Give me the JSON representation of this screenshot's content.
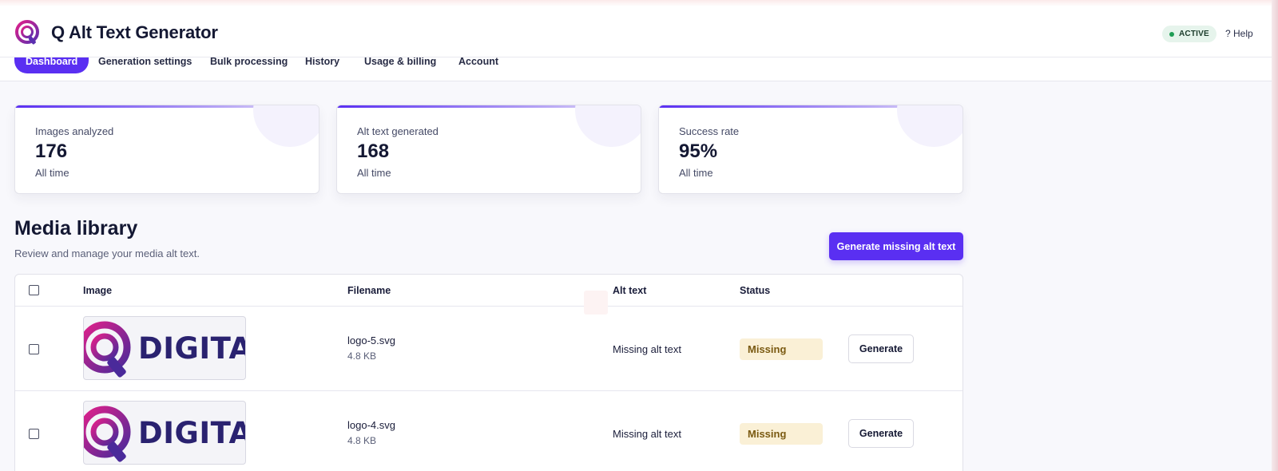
{
  "app": {
    "title": "Q Alt Text Generator",
    "status": "ACTIVE",
    "help": "? Help",
    "accent": "#5a2ff2",
    "logo_icon": "q-logo-icon"
  },
  "nav": {
    "tabs": [
      {
        "label": "Dashboard",
        "active": true
      },
      {
        "label": "Generation settings",
        "active": false
      },
      {
        "label": "Bulk processing",
        "active": false
      },
      {
        "label": "History",
        "active": false
      },
      {
        "label": "Usage & billing",
        "active": false
      },
      {
        "label": "Account",
        "active": false
      }
    ]
  },
  "stats": [
    {
      "label": "Images analyzed",
      "value": "176",
      "sub": "All time"
    },
    {
      "label": "Alt text generated",
      "value": "168",
      "sub": "All time"
    },
    {
      "label": "Success rate",
      "value": "95%",
      "sub": "All time"
    }
  ],
  "media": {
    "title": "Media library",
    "subtitle": "Review and manage your media alt text.",
    "generate_all_label": "Generate missing alt text",
    "columns": {
      "image": "Image",
      "filename": "Filename",
      "alt_text": "Alt text",
      "status": "Status"
    },
    "rows": [
      {
        "thumb_text": "DIGITA",
        "filename": "logo-5.svg",
        "size": "4.8 KB",
        "alt_text": "Missing alt text",
        "status": "Missing",
        "action": "Generate"
      },
      {
        "thumb_text": "DIGITA",
        "filename": "logo-4.svg",
        "size": "4.8 KB",
        "alt_text": "Missing alt text",
        "status": "Missing",
        "action": "Generate"
      }
    ]
  }
}
